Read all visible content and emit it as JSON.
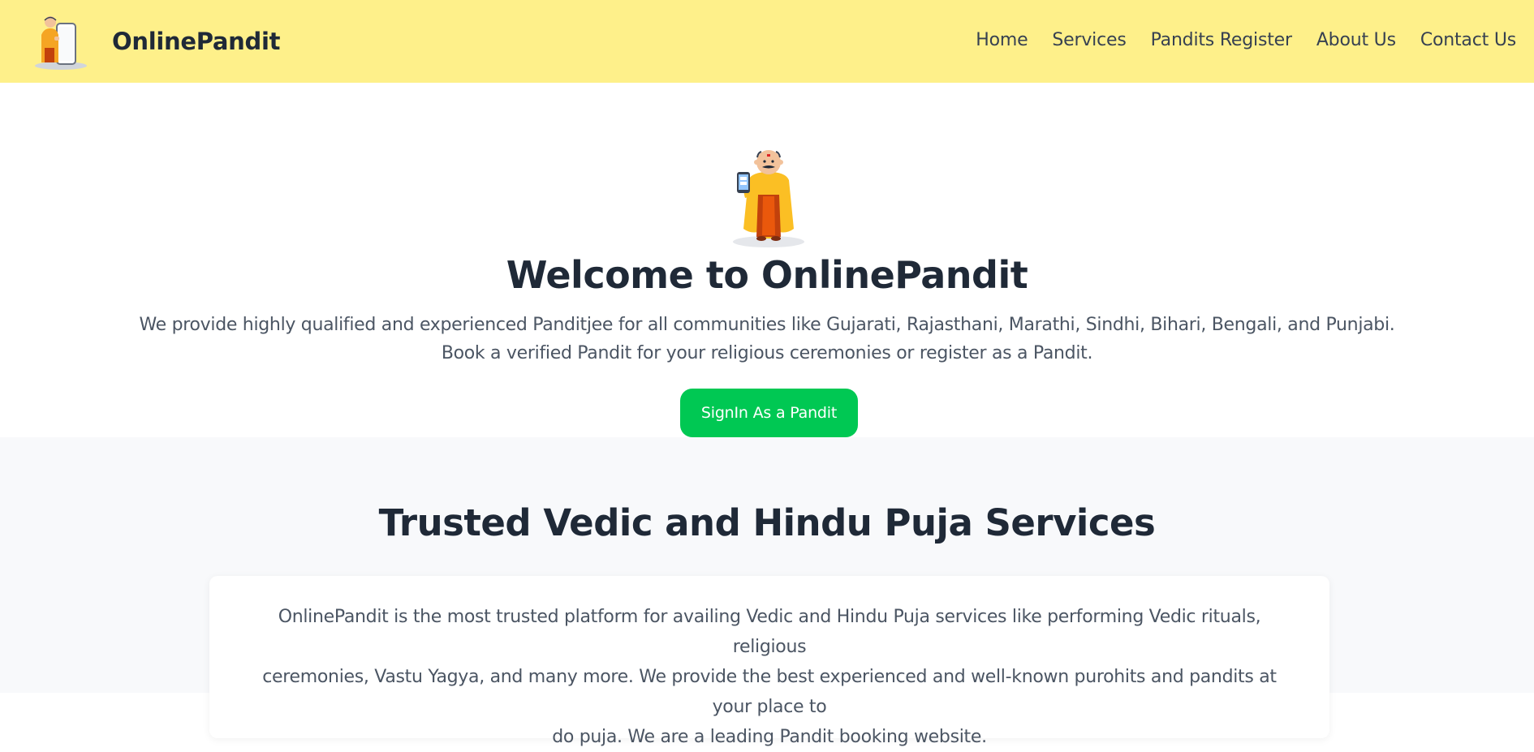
{
  "header": {
    "logo_icon": "pandit-mascot-icon",
    "brand_name": "OnlinePandit",
    "nav": [
      {
        "label": "Home"
      },
      {
        "label": "Services"
      },
      {
        "label": "Pandits Register"
      },
      {
        "label": "About Us"
      },
      {
        "label": "Contact Us"
      }
    ]
  },
  "hero": {
    "mascot_icon": "pandit-with-phone-icon",
    "title": "Welcome to OnlinePandit",
    "line1": "We provide highly qualified and experienced Panditjee for all communities like Gujarati, Rajasthani, Marathi, Sindhi, Bihari, Bengali, and Punjabi.",
    "line2": "Book a verified Pandit for your religious ceremonies or register as a Pandit.",
    "cta_label": "SignIn As a Pandit"
  },
  "services": {
    "title": "Trusted Vedic and Hindu Puja Services",
    "line1": "OnlinePandit is the most trusted platform for availing Vedic and Hindu Puja services like performing Vedic rituals, religious",
    "line2": "ceremonies, Vastu Yagya, and many more. We provide the best experienced and well-known purohits and pandits at your place to",
    "line3": "do puja. We are a leading Pandit booking website."
  },
  "colors": {
    "header_bg": "#fef08a",
    "accent_green": "#00c853",
    "section_bg": "#f8f9fb",
    "heading": "#1f2937",
    "body_text": "#4b5563"
  }
}
